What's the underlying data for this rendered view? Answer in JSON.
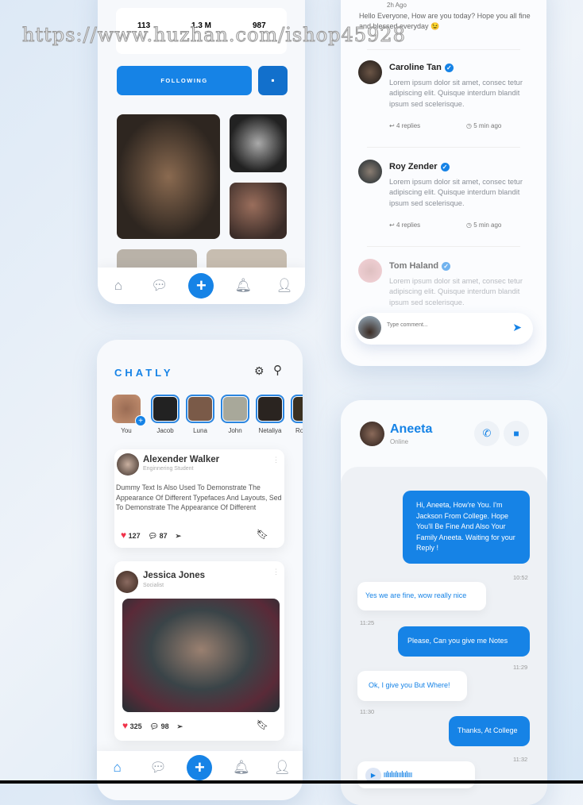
{
  "watermark": "https://www.huzhan.com/ishop45928",
  "profile": {
    "stats": [
      "113",
      "1.3 M",
      "987"
    ],
    "following_label": "FOLLOWING",
    "chat_icon": "chat-bubble-icon"
  },
  "nav": {
    "icons": [
      "home-icon",
      "chat-icon",
      "plus-icon",
      "bell-icon",
      "user-icon"
    ],
    "plus": "+"
  },
  "comments": {
    "top_time": "2h Ago",
    "top_text": "Hello Everyone, How are you today? Hope you all fine and blessed everyday 😉",
    "items": [
      {
        "name": "Caroline Tan",
        "text": "Lorem ipsum dolor sit amet, consec tetur adipiscing elit. Quisque interdum blandit ipsum sed scelerisque.",
        "replies": "4 replies",
        "time": "5 min ago"
      },
      {
        "name": "Roy Zender",
        "text": "Lorem ipsum dolor sit amet, consec tetur adipiscing elit. Quisque interdum blandit ipsum sed scelerisque.",
        "replies": "4 replies",
        "time": "5 min ago"
      },
      {
        "name": "Tom Haland",
        "text": "Lorem ipsum dolor sit amet, consec tetur adipiscing elit. Quisque interdum blandit ipsum sed scelerisque."
      }
    ],
    "input_placeholder": "Type comment..."
  },
  "feed": {
    "logo": "CHATLY",
    "stories": [
      "You",
      "Jacob",
      "Luna",
      "John",
      "Netaliya",
      "Ro"
    ],
    "posts": [
      {
        "name": "Alexender Walker",
        "role": "Enginnering Student",
        "text": "Dummy Text Is Also Used To Demonstrate The Appearance Of Different Typefaces And Layouts, Sed To Demonstrate The Appearance Of Different",
        "likes": "127",
        "comments": "87"
      },
      {
        "name": "Jessica Jones",
        "role": "Socialist",
        "likes": "325",
        "comments": "98"
      }
    ]
  },
  "chat": {
    "name": "Aneeta",
    "status": "Online",
    "messages": [
      {
        "text": "Hi, Aneeta, How're You. I'm Jackson From College. Hope You'll Be Fine And Also Your Family Aneeta. Waiting for your Reply !",
        "time": "10:52"
      },
      {
        "text": "Yes we are fine, wow really nice",
        "time": "11:25"
      },
      {
        "text": "Please, Can you give me Notes",
        "time": "11:29"
      },
      {
        "text": "Ok, I give you But Where!",
        "time": "11:30"
      },
      {
        "text": "Thanks, At College",
        "time": "11:32"
      }
    ]
  },
  "colors": {
    "accent": "#1683e6",
    "like": "#f0324a"
  }
}
